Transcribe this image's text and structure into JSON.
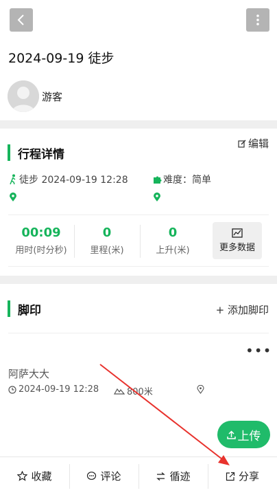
{
  "trip": {
    "title": "2024-09-19 徒步",
    "user": "游客",
    "detail_title": "行程详情",
    "edit_label": "编辑",
    "type_time": "徒步 2024-09-19 12:28",
    "difficulty": "难度：简单",
    "stats": [
      {
        "value": "00:09",
        "label": "用时(时分秒)"
      },
      {
        "value": "0",
        "label": "里程(米)"
      },
      {
        "value": "0",
        "label": "上升(米)"
      }
    ],
    "more_data": "更多数据"
  },
  "footprint": {
    "section_title": "脚印",
    "add_label": "+ 添加脚印",
    "name": "阿萨大大",
    "time": "2024-09-19 12:28",
    "altitude": "800米",
    "more": "•••"
  },
  "upload_label": "上传",
  "tabs": {
    "favorite": "收藏",
    "comment": "评论",
    "follow": "循迹",
    "share": "分享"
  },
  "colors": {
    "accent": "#16b45b",
    "upload": "#20bb6a",
    "annotation_arrow": "#e8322d"
  }
}
